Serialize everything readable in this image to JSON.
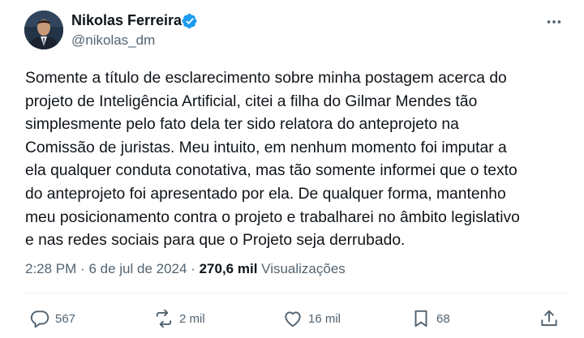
{
  "author": {
    "name": "Nikolas Ferreira",
    "handle": "@nikolas_dm",
    "verified_icon": "verified-badge-icon",
    "verified_color": "#1d9bf0"
  },
  "tweet": {
    "text": "Somente a título de esclarecimento sobre minha postagem acerca do\nprojeto de Inteligência Artificial, citei a filha do Gilmar Mendes tão\nsimplesmente pelo fato dela ter sido relatora do anteprojeto na\nComissão de juristas. Meu intuito, em nenhum momento foi imputar a\nela qualquer conduta conotativa, mas tão somente informei que o texto\ndo anteprojeto foi apresentado por ela. De qualquer forma, mantenho\nmeu posicionamento contra o projeto e trabalharei no âmbito legislativo\ne nas redes sociais para que o Projeto seja derrubado.",
    "time": "2:28 PM",
    "separator": "·",
    "date": "6 de jul de 2024",
    "views_count": "270,6 mil",
    "views_label": "Visualizações"
  },
  "actions": {
    "replies": "567",
    "reposts": "2 mil",
    "likes": "16 mil",
    "bookmarks": "68"
  },
  "colors": {
    "text": "#0f1419",
    "secondary": "#536471",
    "divider": "#eff3f4"
  }
}
